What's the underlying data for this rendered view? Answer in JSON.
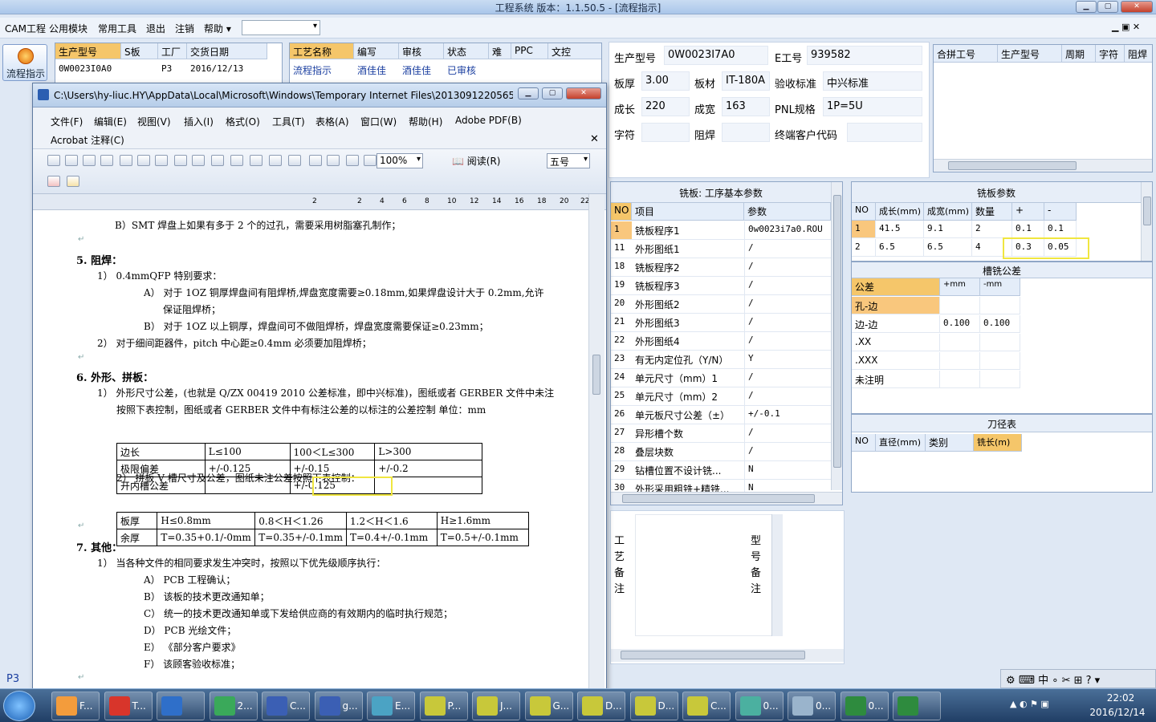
{
  "app": {
    "title": "工程系统    版本：1.1.50.5 - [流程指示]",
    "status": "P3"
  },
  "menu": [
    "CAM工程",
    "公用模块",
    "常用工具",
    "退出",
    "注销",
    "帮助 ▾"
  ],
  "left": {
    "flow_button": "流程指示"
  },
  "grid1": {
    "headers": [
      "生产型号",
      "S板",
      "工厂",
      "交货日期"
    ],
    "row": [
      "0W0023I0A0",
      "",
      "P3",
      "2016/12/13"
    ]
  },
  "grid2": {
    "headers": [
      "工艺名称",
      "编写",
      "审核",
      "状态",
      "难",
      "PPC",
      "文控"
    ],
    "row": [
      "流程指示",
      "酒佳佳",
      "酒佳佳",
      "已审核",
      "",
      "",
      ""
    ]
  },
  "info": {
    "labels": [
      "生产型号",
      "E工号",
      "板厚",
      "板材",
      "验收标准",
      "成长",
      "成宽",
      "PNL规格",
      "字符",
      "阻焊",
      "终端客户代码"
    ],
    "values": {
      "model": "0W0023I7A0",
      "eid": "939582",
      "thick": "3.00",
      "material": "IT-180A",
      "standard": "中兴标准",
      "len": "220",
      "wid": "163",
      "pnl": "1P=5U"
    }
  },
  "merge": {
    "headers": [
      "合拼工号",
      "生产型号",
      "周期",
      "字符",
      "阻焊"
    ]
  },
  "params": {
    "title": "铣板: 工序基本参数",
    "headers": [
      "NO",
      "项目",
      "参数"
    ],
    "rows": [
      [
        "1",
        "铣板程序1",
        "0w0023i7a0.ROU"
      ],
      [
        "11",
        "外形图纸1",
        "/"
      ],
      [
        "18",
        "铣板程序2",
        "/"
      ],
      [
        "19",
        "铣板程序3",
        "/"
      ],
      [
        "20",
        "外形图纸2",
        "/"
      ],
      [
        "21",
        "外形图纸3",
        "/"
      ],
      [
        "22",
        "外形图纸4",
        "/"
      ],
      [
        "23",
        "有无内定位孔（Y/N）",
        "Y"
      ],
      [
        "24",
        "单元尺寸（mm）1",
        "/"
      ],
      [
        "25",
        "单元尺寸（mm）2",
        "/"
      ],
      [
        "26",
        "单元板尺寸公差（±）",
        "+/-0.1"
      ],
      [
        "27",
        "异形槽个数",
        "/"
      ],
      [
        "28",
        "叠层块数",
        "/"
      ],
      [
        "29",
        "钻槽位置不设计铣...",
        "N"
      ],
      [
        "30",
        "外形采用粗铣+精铣...",
        "N"
      ]
    ]
  },
  "mill": {
    "title": "铣板参数",
    "headers": [
      "NO",
      "成长(mm)",
      "成宽(mm)",
      "数量",
      "+",
      "-"
    ],
    "rows": [
      [
        "1",
        "41.5",
        "9.1",
        "2",
        "0.1",
        "0.1"
      ],
      [
        "2",
        "6.5",
        "6.5",
        "4",
        "0.3",
        "0.05"
      ]
    ]
  },
  "slot": {
    "title": "槽铣公差",
    "headers": [
      "公差",
      "+mm",
      "-mm"
    ],
    "rows": [
      [
        "孔-边",
        "",
        ""
      ],
      [
        "边-边",
        "0.100",
        "0.100"
      ],
      [
        ".XX",
        "",
        ""
      ],
      [
        ".XXX",
        "",
        ""
      ],
      [
        "未注明",
        "",
        ""
      ]
    ]
  },
  "knife": {
    "title": "刀径表",
    "headers": [
      "NO",
      "直径(mm)",
      "类别",
      "铣长(m)"
    ]
  },
  "notes": {
    "process": "工艺备注",
    "model": "型号备注"
  },
  "word": {
    "title": "C:\\Users\\hy-liuc.HY\\AppData\\Local\\Microsoft\\Windows\\Temporary Internet Files\\2013091220565...",
    "menu": [
      "文件(F)",
      "编辑(E)",
      "视图(V)",
      "插入(I)",
      "格式(O)",
      "工具(T)",
      "表格(A)",
      "窗口(W)",
      "帮助(H)",
      "Adobe PDF(B)"
    ],
    "menu2": "Acrobat 注释(C)",
    "zoom": "100%",
    "read": "阅读(R)",
    "font_size": "五号",
    "ruler": [
      "2",
      "2",
      "4",
      "6",
      "8",
      "10",
      "12",
      "14",
      "16",
      "18",
      "20",
      "22"
    ],
    "lines": [
      "B）SMT 焊盘上如果有多于 2 个的过孔，需要采用树脂塞孔制作；",
      "5.   阻焊：",
      "1） 0.4mmQFP 特别要求：",
      "A） 对于 1OZ 铜厚焊盘间有阻焊桥,焊盘宽度需要≥0.18mm,如果焊盘设计大于 0.2mm,允许",
      "保证阻焊桥；",
      "B） 对于 1OZ 以上铜厚，焊盘间可不做阻焊桥，焊盘宽度需要保证≥0.23mm；",
      "2） 对于细间距器件，pitch 中心距≥0.4mm 必须要加阻焊桥；",
      "6.   外形、拼板：",
      "1） 外形尺寸公差，(也就是 Q/ZX 00419 2010 公差标准，即中兴标准)，图纸或者 GERBER 文件中未注",
      "按照下表控制，图纸或者 GERBER 文件中有标注公差的以标注的公差控制   单位：mm",
      "2） 拼板 V 槽尺寸及公差，图纸未注公差按照下表控制：",
      "7.   其他：",
      "1） 当各种文件的相同要求发生冲突时，按照以下优先级顺序执行：",
      "A） PCB 工程确认；",
      "B） 该板的技术更改通知单；",
      "C） 统一的技术更改通知单或下发给供应商的有效期内的临时执行规范；",
      "D） PCB 光绘文件；",
      "E） 《部分客户要求》",
      "F） 该顾客验收标准；"
    ],
    "table1": [
      [
        "边长",
        "L≤100",
        "100＜L≤300",
        "L>300"
      ],
      [
        "极限偏差",
        "+/-0.125",
        "+/-0.15",
        "+/-0.2"
      ],
      [
        "开内槽公差",
        "",
        "+/-0.125",
        ""
      ]
    ],
    "table2": [
      [
        "板厚",
        "H≤0.8mm",
        "0.8＜H＜1.26",
        "1.2＜H＜1.6",
        "H≥1.6mm"
      ],
      [
        "余厚",
        "T=0.35+0.1/-0mm",
        "T=0.35+/-0.1mm",
        "T=0.4+/-0.1mm",
        "T=0.5+/-0.1mm"
      ]
    ]
  },
  "taskbar": {
    "items": [
      "F...",
      "T...",
      "",
      "2...",
      "C...",
      "g...",
      "E...",
      "P...",
      "J...",
      "G...",
      "D...",
      "D...",
      "C...",
      "0...",
      "0...",
      "0...",
      ""
    ],
    "time": "22:02",
    "date": "2016/12/14",
    "ime": "中"
  },
  "colors": {
    "highlight": "#f0e640",
    "selected": "#f9c77d",
    "accent_text": "#1b3fa0"
  }
}
